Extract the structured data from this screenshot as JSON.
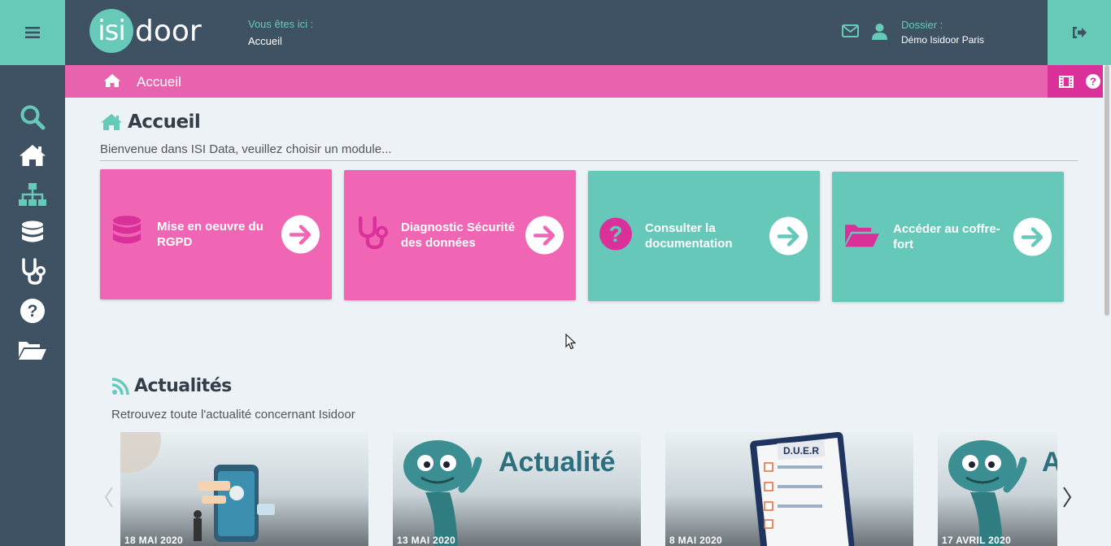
{
  "header": {
    "logo_left": "isi",
    "logo_right": "door",
    "here_label": "Vous êtes ici :",
    "here_value": "Accueil",
    "dossier_label": "Dossier :",
    "dossier_value": "Démo Isidoor Paris"
  },
  "breadcrumb": {
    "title": "Accueil"
  },
  "sidebar": {
    "items": [
      "search-icon",
      "home-icon",
      "sitemap-icon",
      "database-icon",
      "stethoscope-icon",
      "question-icon",
      "folder-open-icon"
    ]
  },
  "main": {
    "title": "Accueil",
    "subtitle": "Bienvenue dans ISI Data, veuillez choisir un module...",
    "modules": [
      {
        "label": "Mise en oeuvre du RGPD",
        "icon": "database-icon",
        "color": "#f066b5"
      },
      {
        "label": "Diagnostic Sécurité des données",
        "icon": "stethoscope-icon",
        "color": "#f066b5"
      },
      {
        "label": "Consulter la documentation",
        "icon": "question-icon",
        "color": "#66c8b9"
      },
      {
        "label": "Accéder au coffre-fort",
        "icon": "folder-open-icon",
        "color": "#66c8b9"
      }
    ]
  },
  "news": {
    "title": "Actualités",
    "subtitle": "Retrouvez toute l'actualité concernant Isidoor",
    "items": [
      {
        "date": "18 MAI 2020"
      },
      {
        "date": "13 MAI 2020",
        "image_text": "Actualité"
      },
      {
        "date": "8 MAI 2020",
        "image_text": "D.U.E.R"
      },
      {
        "date": "17 AVRIL 2020",
        "image_text": "A"
      }
    ]
  },
  "colors": {
    "teal": "#67c9b8",
    "slate": "#3e5264",
    "pink": "#e863ad",
    "magenta": "#d9309a"
  }
}
